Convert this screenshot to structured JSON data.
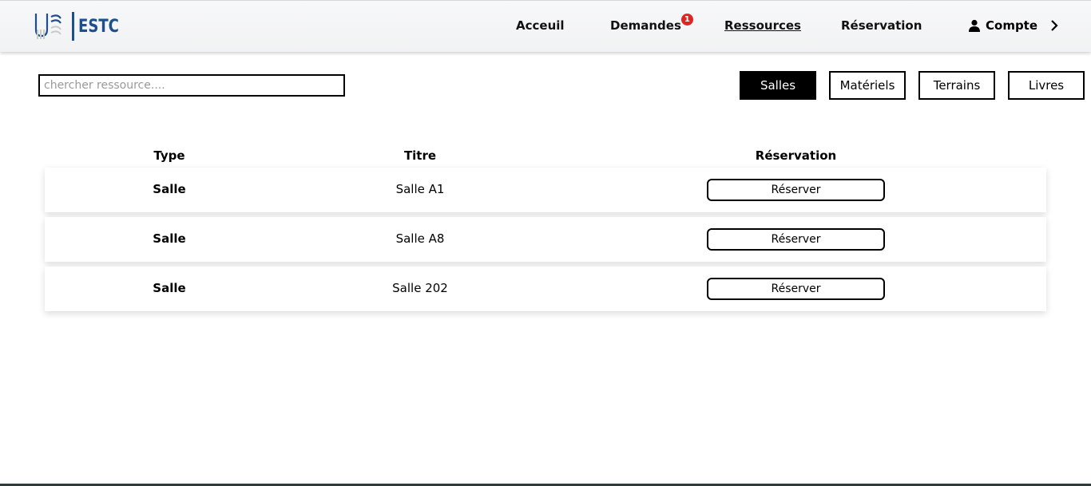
{
  "brand": {
    "text": "ESTC",
    "color": "#1f4e8c"
  },
  "nav": {
    "items": [
      {
        "label": "Acceuil"
      },
      {
        "label": "Demandes",
        "badge": "1"
      },
      {
        "label": "Ressources",
        "active": true
      },
      {
        "label": "Réservation"
      }
    ],
    "account": {
      "label": "Compte",
      "icon": "user-icon",
      "chevron": "chevron-right-icon"
    }
  },
  "search": {
    "placeholder": "chercher ressource....",
    "value": ""
  },
  "filters": [
    {
      "label": "Salles",
      "active": true
    },
    {
      "label": "Matériels"
    },
    {
      "label": "Terrains"
    },
    {
      "label": "Livres"
    }
  ],
  "table": {
    "headers": {
      "type": "Type",
      "title": "Titre",
      "reservation": "Réservation"
    },
    "rows": [
      {
        "type": "Salle",
        "title": "Salle A1",
        "action": "Réserver"
      },
      {
        "type": "Salle",
        "title": "Salle A8",
        "action": "Réserver"
      },
      {
        "type": "Salle",
        "title": "Salle 202",
        "action": "Réserver"
      }
    ]
  },
  "colors": {
    "badge": "#e02424",
    "active_filter_bg": "#000000"
  }
}
